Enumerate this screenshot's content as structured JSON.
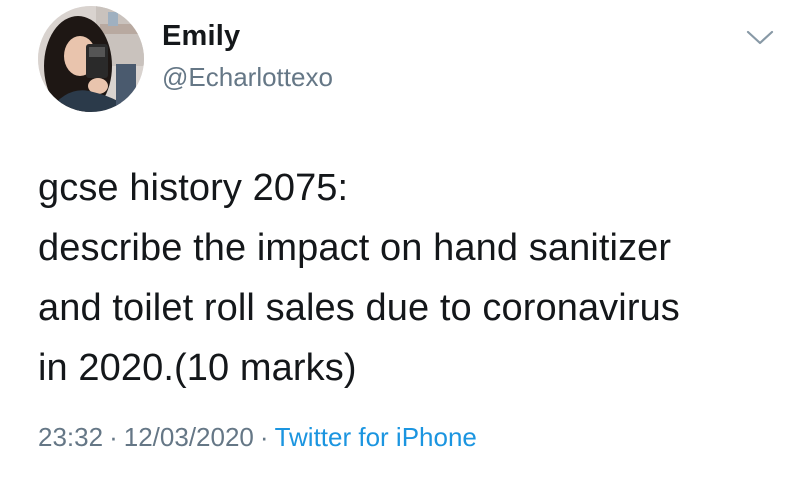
{
  "author": {
    "display_name": "Emily",
    "handle": "@Echarlottexo",
    "avatar_icon": "profile-photo"
  },
  "menu": {
    "caret_icon": "chevron-down-icon"
  },
  "tweet": {
    "lines": [
      "gcse history 2075:",
      "describe the impact on hand sanitizer",
      "and toilet roll sales due to coronavirus",
      "in 2020.(10 marks)"
    ]
  },
  "meta": {
    "time": "23:32",
    "date": "12/03/2020",
    "separator": "·",
    "source": "Twitter for iPhone"
  },
  "colors": {
    "text": "#14171a",
    "secondary": "#657786",
    "link": "#1b95e0"
  }
}
